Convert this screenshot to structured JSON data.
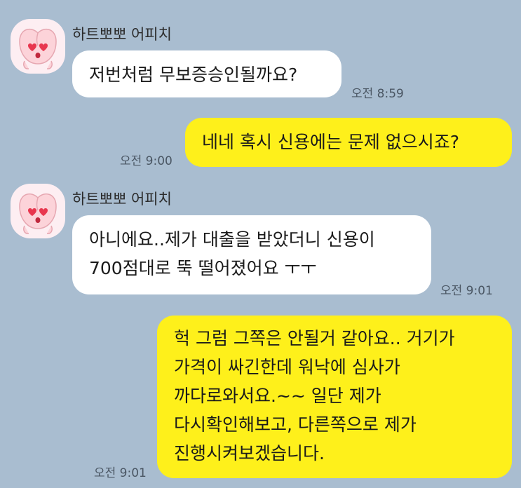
{
  "colors": {
    "background": "#a9bdd0",
    "incoming_bubble": "#ffffff",
    "outgoing_bubble": "#fef01b",
    "avatar_bg": "#fdeef2"
  },
  "messages": [
    {
      "direction": "incoming",
      "sender": "하트뽀뽀 어피치",
      "avatar_icon": "apeach-heart-eyes-icon",
      "lines": [
        "저번처럼 무보증승인될까요?"
      ],
      "time": "오전 8:59"
    },
    {
      "direction": "outgoing",
      "lines": [
        "네네 혹시 신용에는 문제 없으시죠?"
      ],
      "time": "오전 9:00"
    },
    {
      "direction": "incoming",
      "sender": "하트뽀뽀 어피치",
      "avatar_icon": "apeach-heart-eyes-icon",
      "lines": [
        "아니에요..제가 대출을 받았더니 신용이",
        "700점대로 뚝 떨어졌어요 ㅜㅜ"
      ],
      "time": "오전 9:01"
    },
    {
      "direction": "outgoing",
      "lines": [
        "헉 그럼 그쪽은 안될거 같아요.. 거기가",
        "가격이 싸긴한데 워낙에 심사가",
        "까다로와서요.~~ 일단 제가",
        "다시확인해보고, 다른쪽으로 제가",
        "진행시켜보겠습니다."
      ],
      "time": "오전 9:01"
    }
  ]
}
